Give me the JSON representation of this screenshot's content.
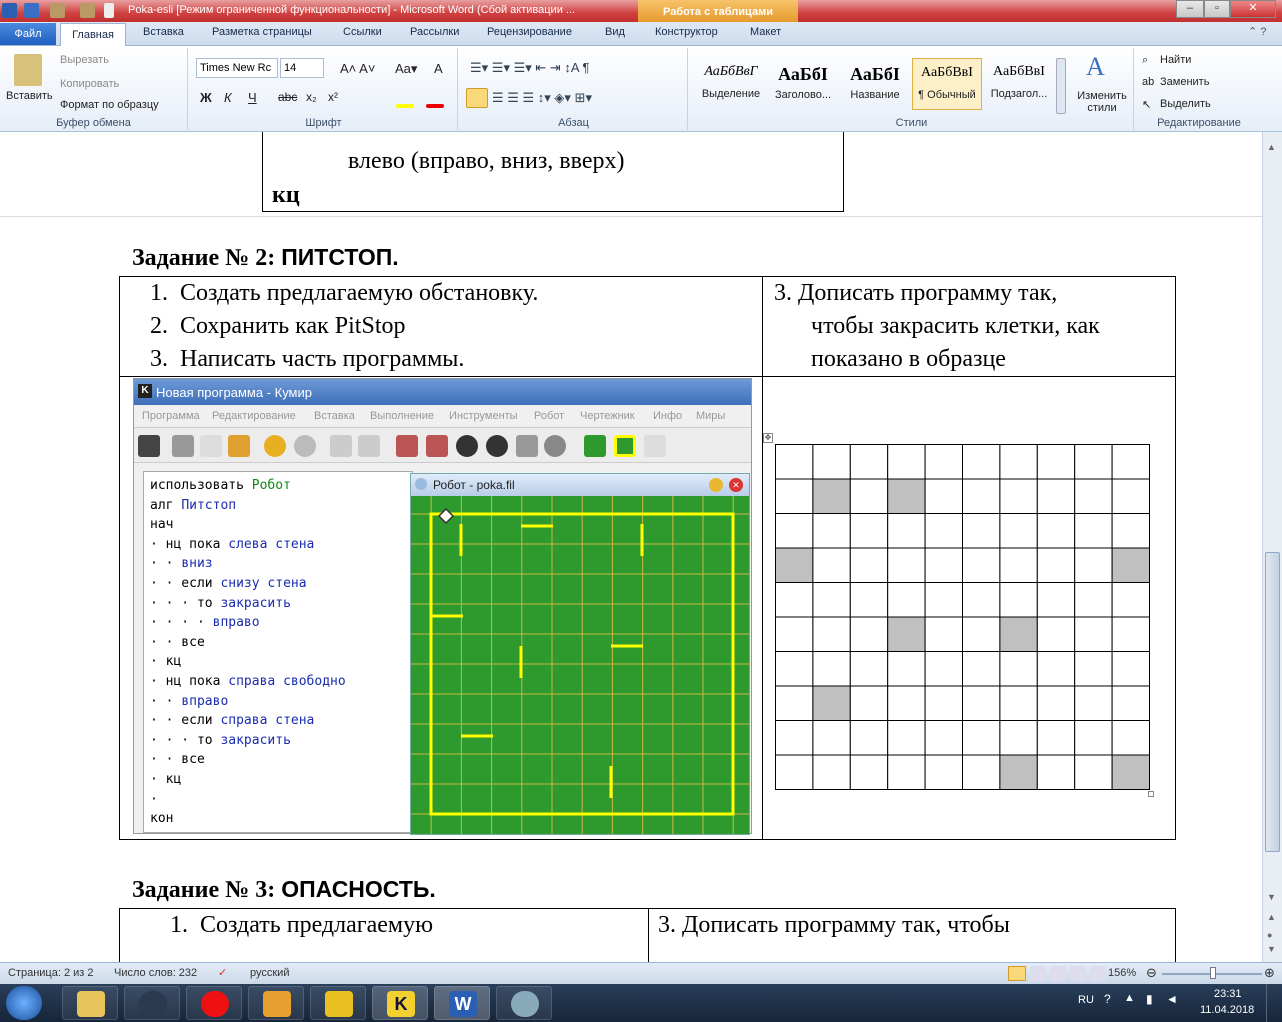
{
  "window": {
    "title": "Poka-esli [Режим ограниченной функциональности]  -  Microsoft Word (Сбой активации ...",
    "context_tab": "Работа с таблицами"
  },
  "tabs": [
    "Файл",
    "Главная",
    "Вставка",
    "Разметка страницы",
    "Ссылки",
    "Рассылки",
    "Рецензирование",
    "Вид",
    "Конструктор",
    "Макет"
  ],
  "ribbon": {
    "clipboard": {
      "paste": "Вставить",
      "cut": "Вырезать",
      "copy": "Копировать",
      "format": "Формат по образцу",
      "label": "Буфер обмена"
    },
    "font": {
      "name": "Times New Rc",
      "size": "14",
      "label": "Шрифт"
    },
    "paragraph": {
      "label": "Абзац"
    },
    "styles": {
      "items": [
        {
          "sample": "АаБбВвГ",
          "name": "Выделение"
        },
        {
          "sample": "АаБбI",
          "name": "Заголово..."
        },
        {
          "sample": "АаБбI",
          "name": "Название"
        },
        {
          "sample": "АаБбВвI",
          "name": "¶ Обычный"
        },
        {
          "sample": "АаБбВвI",
          "name": "Подзагол..."
        }
      ],
      "change": "Изменить стили",
      "label": "Стили"
    },
    "editing": {
      "find": "Найти",
      "replace": "Заменить",
      "select": "Выделить",
      "label": "Редактирование"
    }
  },
  "doc": {
    "top_cell_line1": "влево (вправо, вниз, вверх)",
    "top_cell_line2": "кц",
    "task2_prefix": "Задание № 2: ",
    "task2_title": "ПИТСТОП.",
    "task2_left": [
      "Создать предлагаемую обстановку.",
      "Сохранить как PitStop",
      "Написать часть программы."
    ],
    "task2_right_num": "3.",
    "task2_right": [
      "Дописать программу так,",
      "чтобы закрасить клетки, как",
      "показано в образце"
    ],
    "task3_prefix": "Задание № 3: ",
    "task3_title": "ОПАСНОСТЬ.",
    "task3_left": "Создать предлагаемую",
    "task3_right": "3. Дописать программу так, чтобы"
  },
  "kumir": {
    "title": "Новая программа - Кумир",
    "menu": [
      "Программа",
      "Редактирование",
      "Вставка",
      "Выполнение",
      "Инструменты",
      "Робот",
      "Чертежник",
      "Инфо",
      "Миры"
    ],
    "robot_title": "Робот - poka.fil",
    "code": [
      [
        [
          "использовать ",
          "kw"
        ],
        [
          "Робот",
          "gr"
        ]
      ],
      [
        [
          "алг ",
          "kw"
        ],
        [
          "Питстоп",
          "bl"
        ]
      ],
      [
        [
          "нач",
          "kw"
        ]
      ],
      [
        [
          "· нц пока ",
          "kw"
        ],
        [
          "слева стена",
          "bl"
        ]
      ],
      [
        [
          "· · ",
          "kw"
        ],
        [
          "вниз",
          "bl"
        ]
      ],
      [
        [
          "· · если ",
          "kw"
        ],
        [
          "снизу стена",
          "bl"
        ]
      ],
      [
        [
          "· · · то ",
          "kw"
        ],
        [
          "закрасить",
          "bl"
        ]
      ],
      [
        [
          "· · · · ",
          "kw"
        ],
        [
          "вправо",
          "bl"
        ]
      ],
      [
        [
          "· · все",
          "kw"
        ]
      ],
      [
        [
          "· кц",
          "kw"
        ]
      ],
      [
        [
          "· нц пока ",
          "kw"
        ],
        [
          "справа свободно",
          "bl"
        ]
      ],
      [
        [
          "· · ",
          "kw"
        ],
        [
          "вправо",
          "bl"
        ]
      ],
      [
        [
          "· · если ",
          "kw"
        ],
        [
          "справа стена",
          "bl"
        ]
      ],
      [
        [
          "· · · то ",
          "kw"
        ],
        [
          "закрасить",
          "bl"
        ]
      ],
      [
        [
          "· · все",
          "kw"
        ]
      ],
      [
        [
          "· кц",
          "kw"
        ]
      ],
      [
        [
          "·",
          "kw"
        ]
      ],
      [
        [
          "кон",
          "kw"
        ]
      ]
    ]
  },
  "pattern": {
    "rows": 10,
    "cols": 10,
    "shaded": [
      [
        1,
        1
      ],
      [
        1,
        3
      ],
      [
        3,
        0
      ],
      [
        3,
        9
      ],
      [
        5,
        3
      ],
      [
        5,
        6
      ],
      [
        7,
        1
      ],
      [
        9,
        6
      ],
      [
        9,
        9
      ]
    ]
  },
  "status": {
    "page": "Страница: 2 из 2",
    "words": "Число слов: 232",
    "lang": "русский",
    "zoom": "156%"
  },
  "taskbar": {
    "lang": "RU",
    "time": "23:31",
    "date": "11.04.2018"
  }
}
